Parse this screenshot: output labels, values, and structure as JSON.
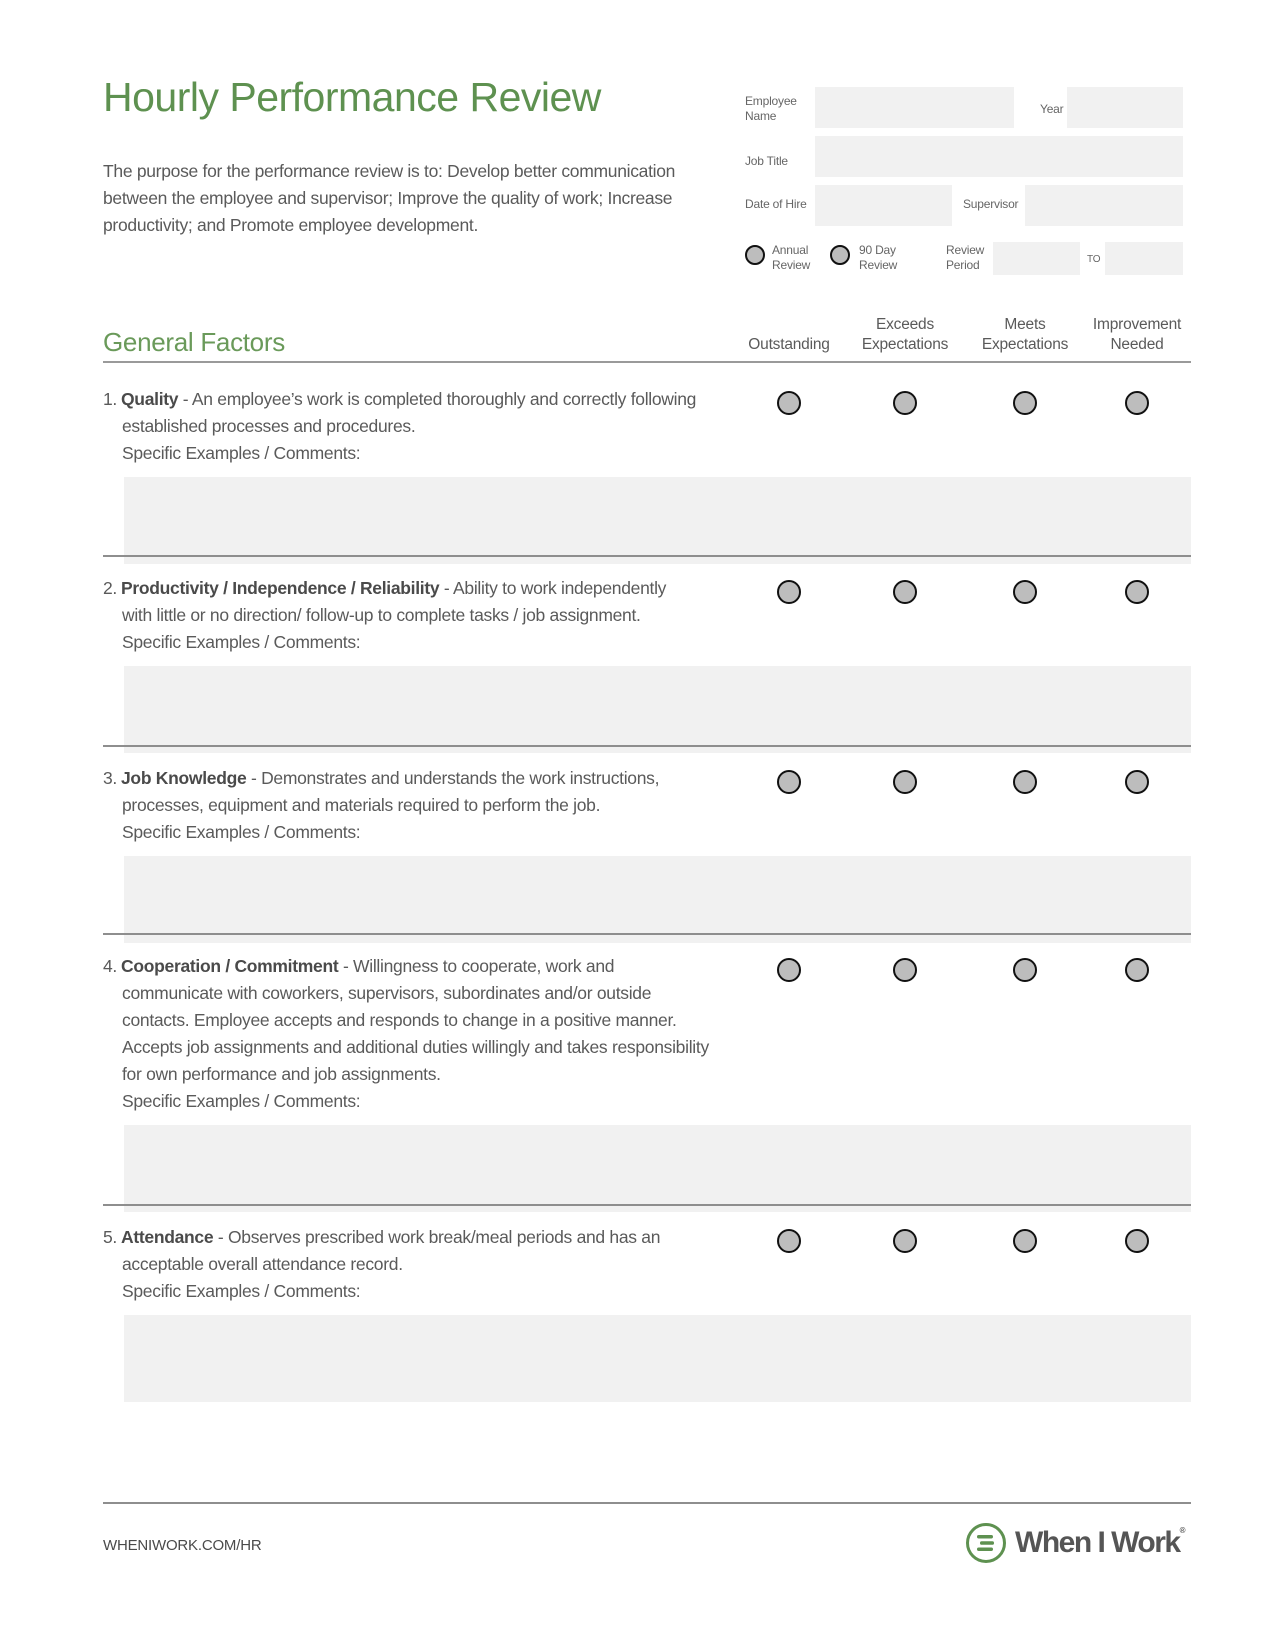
{
  "header": {
    "title": "Hourly Performance Review",
    "description": "The purpose for the performance review is to: Develop better communication between the employee and supervisor; Improve the quality of work; Increase productivity; and Promote employee development."
  },
  "fields": {
    "employee_name_label_1": "Employee",
    "employee_name_label_2": "Name",
    "employee_name_value": "",
    "year_label": "Year",
    "year_value": "",
    "job_title_label": "Job Title",
    "job_title_value": "",
    "date_of_hire_label": "Date of Hire",
    "date_of_hire_value": "",
    "supervisor_label": "Supervisor",
    "supervisor_value": "",
    "annual_review_label_1": "Annual",
    "annual_review_label_2": "Review",
    "ninety_day_label_1": "90 Day",
    "ninety_day_label_2": "Review",
    "review_period_label_1": "Review",
    "review_period_label_2": "Period",
    "review_period_from": "",
    "to_label": "TO",
    "review_period_to": ""
  },
  "section": {
    "title": "General Factors",
    "columns": [
      {
        "line1": "",
        "line2": "Outstanding"
      },
      {
        "line1": "Exceeds",
        "line2": "Expectations"
      },
      {
        "line1": "Meets",
        "line2": "Expectations"
      },
      {
        "line1": "Improvement",
        "line2": "Needed"
      }
    ],
    "comments_label": "Specific Examples / Comments:"
  },
  "items": [
    {
      "number": "1.",
      "name": "Quality",
      "first_line": " - An employee’s work is completed thoroughly and correctly following",
      "rest": [
        "established processes and procedures."
      ],
      "rating": null,
      "comments": ""
    },
    {
      "number": "2.",
      "name": "Productivity / Independence / Reliability",
      "first_line": " - Ability to work independently",
      "rest": [
        "with little or no direction/ follow-up to complete tasks / job assignment."
      ],
      "rating": null,
      "comments": ""
    },
    {
      "number": "3.",
      "name": "Job Knowledge",
      "first_line": " - Demonstrates and understands the work instructions,",
      "rest": [
        "processes, equipment and materials required to perform the job."
      ],
      "rating": null,
      "comments": ""
    },
    {
      "number": "4.",
      "name": "Cooperation / Commitment",
      "first_line": " - Willingness to cooperate, work and",
      "rest": [
        "communicate with coworkers, supervisors, subordinates and/or outside",
        "contacts. Employee accepts and responds to change in a positive manner.",
        "Accepts job assignments and additional duties willingly and takes responsibility",
        "for own  performance and job assignments."
      ],
      "rating": null,
      "comments": ""
    },
    {
      "number": "5.",
      "name": "Attendance",
      "first_line": " - Observes prescribed work break/meal periods and has an",
      "rest": [
        "acceptable overall attendance record."
      ],
      "rating": null,
      "comments": ""
    }
  ],
  "footer": {
    "url": "WHENIWORK.COM/HR",
    "brand": "When I Work",
    "brand_mark": "®"
  },
  "colors": {
    "accent_green": "#5e9150",
    "field_fill": "#f1f1f1",
    "radio_fill": "#bdbdbd"
  }
}
